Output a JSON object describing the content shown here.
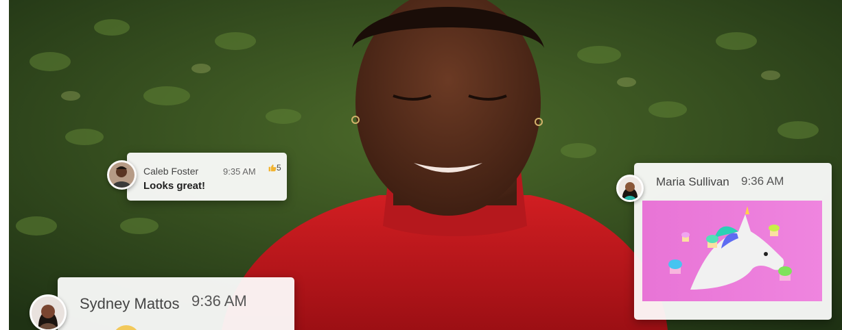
{
  "messages": [
    {
      "name": "Caleb Foster",
      "time": "9:35 AM",
      "text": "Looks great!",
      "reaction_count": "5"
    },
    {
      "name": "Maria Sullivan",
      "time": "9:36 AM"
    },
    {
      "name": "Sydney Mattos",
      "time": "9:36 AM"
    }
  ],
  "icons": {
    "reaction": "thumbs-up-icon",
    "attachment": "unicorn-image"
  },
  "colors": {
    "sweater": "#c3161b",
    "foliage": "#2f4a1e",
    "gif_bg": "#e874d6",
    "reaction": "#f2b431"
  }
}
